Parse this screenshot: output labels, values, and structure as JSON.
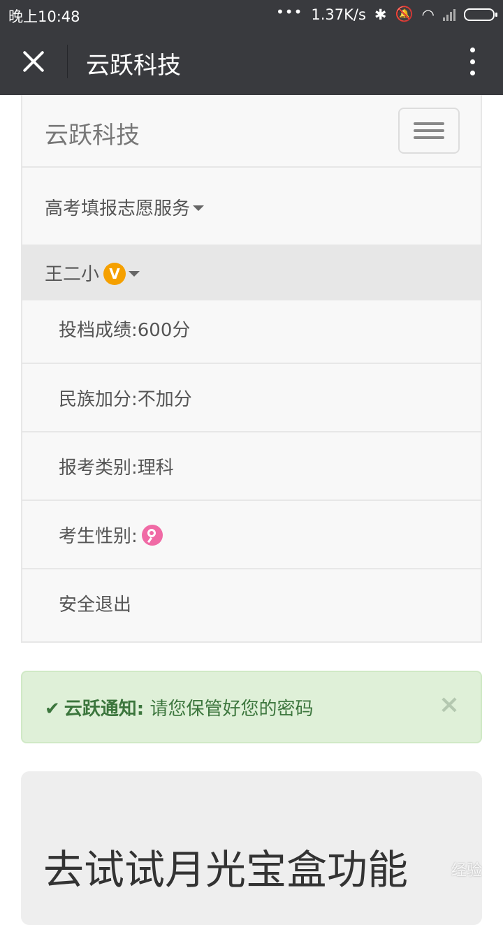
{
  "status": {
    "time": "晚上10:48",
    "net_speed": "1.37K/s"
  },
  "header": {
    "title": "云跃科技"
  },
  "navbar": {
    "brand": "云跃科技",
    "menu": "高考填报志愿服务",
    "user": "王二小",
    "vip_badge": "V",
    "items": [
      {
        "label": "投档成绩:600分"
      },
      {
        "label": "民族加分:不加分"
      },
      {
        "label": "报考类别:理科"
      },
      {
        "label": "考生性别:"
      },
      {
        "label": "安全退出"
      }
    ]
  },
  "alert": {
    "check": "✔",
    "title": "云跃通知:",
    "message": "请您保管好您的密码",
    "close": "×"
  },
  "jumbotron": {
    "heading": "去试试月光宝盒功能"
  },
  "watermark": "经验",
  "colors": {
    "bar": "#393a3e",
    "alert_bg": "#dff0d8",
    "alert_text": "#3c763d",
    "vip": "#f5a000",
    "female": "#f06aa5"
  }
}
